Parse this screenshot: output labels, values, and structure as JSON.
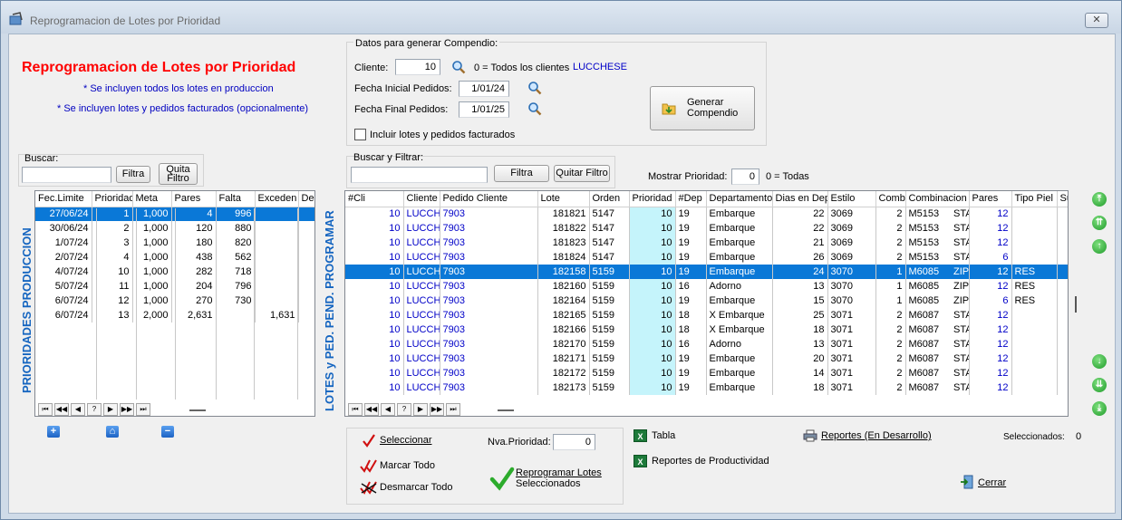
{
  "window": {
    "title": "Reprogramacion de Lotes por Prioridad",
    "close_label": "✕"
  },
  "header": {
    "heading": "Reprogramacion de Lotes por Prioridad",
    "note1": "* Se incluyen todos los lotes en produccion",
    "note2": "* Se incluyen lotes y pedidos facturados (opcionalmente)"
  },
  "compendio": {
    "legend": "Datos para generar Compendio:",
    "cliente_label": "Cliente:",
    "cliente_value": "10",
    "cliente_hint": "0 = Todos los clientes",
    "cliente_name": "LUCCHESE",
    "fecha_inicial_label": "Fecha Inicial Pedidos:",
    "fecha_inicial_value": "1/01/24",
    "fecha_final_label": "Fecha Final Pedidos:",
    "fecha_final_value": "1/01/25",
    "incluir_label": "Incluir lotes y pedidos facturados",
    "generar_line1": "Generar",
    "generar_line2": "Compendio"
  },
  "left_search": {
    "label": "Buscar:",
    "value": "",
    "filtra": "Filtra",
    "quita1": "Quita",
    "quita2": "Filtro"
  },
  "right_search": {
    "label": "Buscar y Filtrar:",
    "value": "",
    "filtra": "Filtra",
    "quita": "Quitar Filtro"
  },
  "mostrar": {
    "label": "Mostrar Prioridad:",
    "value": "0",
    "hint": "0 = Todas"
  },
  "left_vertical": "PRIORIDADES PRODUCCION",
  "right_vertical": "LOTES y PED. PEND. PROGRAMAR",
  "prior_grid": {
    "columns": [
      "Fec.Limite",
      "Prioridad",
      "Meta",
      "Pares",
      "Falta",
      "Exceden",
      "De"
    ],
    "rows": [
      [
        "27/06/24",
        "1",
        "1,000",
        "4",
        "996",
        "",
        ""
      ],
      [
        "30/06/24",
        "2",
        "1,000",
        "120",
        "880",
        "",
        ""
      ],
      [
        "1/07/24",
        "3",
        "1,000",
        "180",
        "820",
        "",
        ""
      ],
      [
        "2/07/24",
        "4",
        "1,000",
        "438",
        "562",
        "",
        ""
      ],
      [
        "4/07/24",
        "10",
        "1,000",
        "282",
        "718",
        "",
        ""
      ],
      [
        "5/07/24",
        "11",
        "1,000",
        "204",
        "796",
        "",
        ""
      ],
      [
        "6/07/24",
        "12",
        "1,000",
        "270",
        "730",
        "",
        ""
      ],
      [
        "6/07/24",
        "13",
        "2,000",
        "2,631",
        "",
        "1,631",
        ""
      ]
    ],
    "selected_row": 0
  },
  "lotes_grid": {
    "columns": [
      "#Cli",
      "Cliente",
      "Pedido Cliente",
      "Lote",
      "Orden",
      "Prioridad",
      "#Dep",
      "Departamento",
      "Dias en Dep",
      "Estilo",
      "Comb",
      "Combinacion",
      "Pares",
      "Tipo Piel",
      "Su"
    ],
    "rows": [
      [
        "10",
        "LUCCHE",
        "7903",
        "181821",
        "5147",
        "10",
        "19",
        "Embarque",
        "22",
        "3069",
        "2",
        "M5153",
        "STA",
        "12",
        ""
      ],
      [
        "10",
        "LUCCHE",
        "7903",
        "181822",
        "5147",
        "10",
        "19",
        "Embarque",
        "22",
        "3069",
        "2",
        "M5153",
        "STA",
        "12",
        ""
      ],
      [
        "10",
        "LUCCHE",
        "7903",
        "181823",
        "5147",
        "10",
        "19",
        "Embarque",
        "21",
        "3069",
        "2",
        "M5153",
        "STA",
        "12",
        ""
      ],
      [
        "10",
        "LUCCHE",
        "7903",
        "181824",
        "5147",
        "10",
        "19",
        "Embarque",
        "26",
        "3069",
        "2",
        "M5153",
        "STA",
        "6",
        ""
      ],
      [
        "10",
        "LUCCHE",
        "7903",
        "182158",
        "5159",
        "10",
        "19",
        "Embarque",
        "24",
        "3070",
        "1",
        "M6085",
        "ZIP BC",
        "12",
        "RES"
      ],
      [
        "10",
        "LUCCHE",
        "7903",
        "182160",
        "5159",
        "10",
        "16",
        "Adorno",
        "13",
        "3070",
        "1",
        "M6085",
        "ZIP BC",
        "12",
        "RES"
      ],
      [
        "10",
        "LUCCHE",
        "7903",
        "182164",
        "5159",
        "10",
        "19",
        "Embarque",
        "15",
        "3070",
        "1",
        "M6085",
        "ZIP BC",
        "6",
        "RES"
      ],
      [
        "10",
        "LUCCHE",
        "7903",
        "182165",
        "5159",
        "10",
        "18",
        "X Embarque",
        "25",
        "3071",
        "2",
        "M6087",
        "STAR",
        "12",
        ""
      ],
      [
        "10",
        "LUCCHE",
        "7903",
        "182166",
        "5159",
        "10",
        "18",
        "X Embarque",
        "18",
        "3071",
        "2",
        "M6087",
        "STAR",
        "12",
        ""
      ],
      [
        "10",
        "LUCCHE",
        "7903",
        "182170",
        "5159",
        "10",
        "16",
        "Adorno",
        "13",
        "3071",
        "2",
        "M6087",
        "STAR",
        "12",
        ""
      ],
      [
        "10",
        "LUCCHE",
        "7903",
        "182171",
        "5159",
        "10",
        "19",
        "Embarque",
        "20",
        "3071",
        "2",
        "M6087",
        "STAR",
        "12",
        ""
      ],
      [
        "10",
        "LUCCHE",
        "7903",
        "182172",
        "5159",
        "10",
        "19",
        "Embarque",
        "14",
        "3071",
        "2",
        "M6087",
        "STAR",
        "12",
        ""
      ],
      [
        "10",
        "LUCCHE",
        "7903",
        "182173",
        "5159",
        "10",
        "19",
        "Embarque",
        "18",
        "3071",
        "2",
        "M6087",
        "STAR",
        "12",
        ""
      ]
    ],
    "selected_row": 4
  },
  "nav_buttons": [
    "⏮",
    "◀◀",
    "◀",
    "?",
    "▶",
    "▶▶",
    "⏭"
  ],
  "actions": {
    "seleccionar": "Seleccionar",
    "marcar": "Marcar Todo",
    "desmarcar": "Desmarcar Todo",
    "nva_label": "Nva.Prioridad:",
    "nva_value": "0",
    "reprogramar1": "Reprogramar Lotes",
    "reprogramar2": "Seleccionados",
    "tabla": "Tabla",
    "reportes_prod": "Reportes de Productividad",
    "reportes_des": "Reportes (En Desarrollo)",
    "seleccionados_label": "Seleccionados:",
    "seleccionados_value": "0",
    "cerrar": "Cerrar"
  }
}
